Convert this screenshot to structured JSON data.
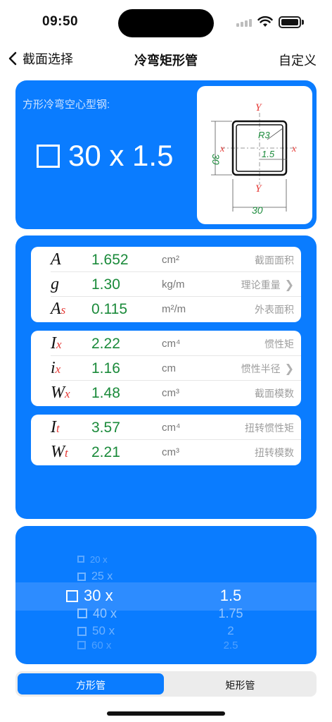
{
  "status": {
    "time": "09:50"
  },
  "nav": {
    "back": "截面选择",
    "title": "冷弯矩形管",
    "right": "自定义"
  },
  "header": {
    "subtitle": "方形冷弯空心型钢:",
    "size": "30 x 1.5",
    "diagram": {
      "axis_y": "Y",
      "axis_x": "x",
      "radius": "R3",
      "thickness": "1.5",
      "height": "30",
      "width": "30"
    }
  },
  "groups": [
    {
      "rows": [
        {
          "sym": "A",
          "sub": "",
          "value": "1.652",
          "unit": "cm²",
          "desc": "截面面积",
          "chevron": false
        },
        {
          "sym": "g",
          "sub": "",
          "value": "1.30",
          "unit": "kg/m",
          "desc": "理论重量",
          "chevron": true
        },
        {
          "sym": "A",
          "sub": "s",
          "value": "0.115",
          "unit": "m²/m",
          "desc": "外表面积",
          "chevron": false
        }
      ]
    },
    {
      "rows": [
        {
          "sym": "I",
          "sub": "x",
          "value": "2.22",
          "unit": "cm⁴",
          "desc": "惯性矩",
          "chevron": false
        },
        {
          "sym": "i",
          "sub": "x",
          "value": "1.16",
          "unit": "cm",
          "desc": "惯性半径",
          "chevron": true
        },
        {
          "sym": "W",
          "sub": "x",
          "value": "1.48",
          "unit": "cm³",
          "desc": "截面模数",
          "chevron": false
        }
      ]
    },
    {
      "rows": [
        {
          "sym": "I",
          "sub": "t",
          "value": "3.57",
          "unit": "cm⁴",
          "desc": "扭转惯性矩",
          "chevron": false
        },
        {
          "sym": "W",
          "sub": "t",
          "value": "2.21",
          "unit": "cm³",
          "desc": "扭转模数",
          "chevron": false
        }
      ]
    }
  ],
  "picker": {
    "size_options": [
      "20 x",
      "25 x",
      "30 x",
      "40 x",
      "50 x",
      "60 x"
    ],
    "selected_size": "30 x",
    "thickness_options": [
      "1.5",
      "1.75",
      "2",
      "2.5"
    ],
    "selected_thickness": "1.5"
  },
  "segments": {
    "left": "方形管",
    "right": "矩形管",
    "selected": "方形管"
  },
  "colors": {
    "accent": "#0a7cff",
    "value": "#1a8a3a",
    "subscript": "#e53935"
  }
}
